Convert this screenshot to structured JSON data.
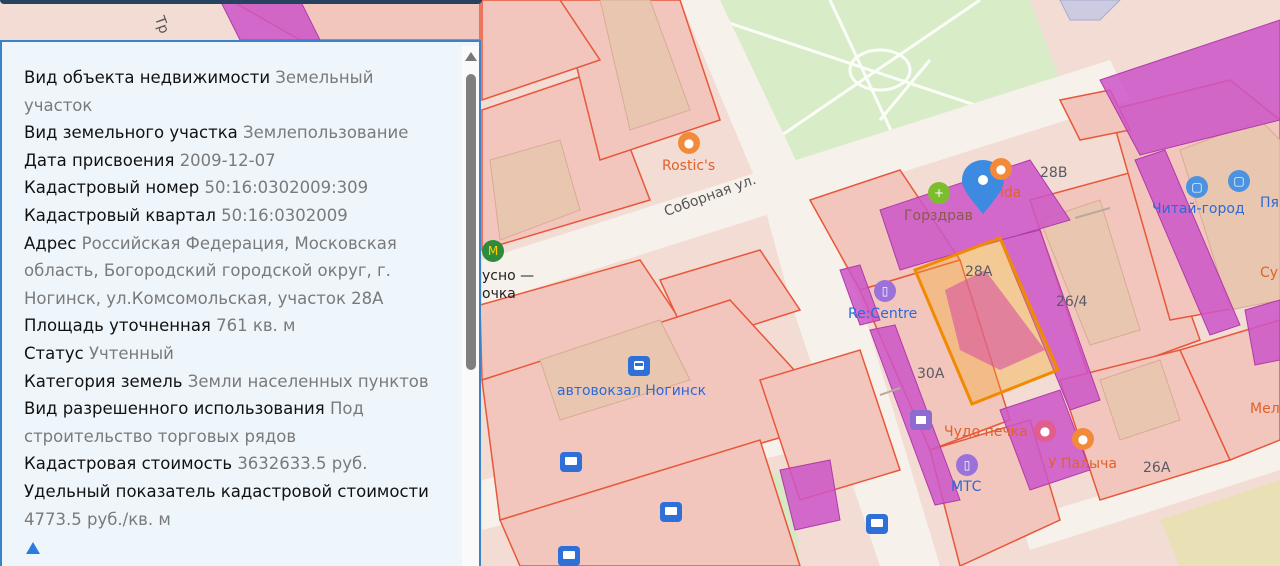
{
  "info_panel": {
    "rows": [
      {
        "label": "Вид объекта недвижимости",
        "value": "Земельный участок"
      },
      {
        "label": "Вид земельного участка",
        "value": "Землепользование"
      },
      {
        "label": "Дата присвоения",
        "value": "2009-12-07"
      },
      {
        "label": "Кадастровый номер",
        "value": "50:16:0302009:309"
      },
      {
        "label": "Кадастровый квартал",
        "value": "50:16:0302009"
      },
      {
        "label": "Адрес",
        "value": "Российская Федерация, Московская область, Богородский городской округ, г. Ногинск, ул.Комсомольская, участок 28А"
      },
      {
        "label": "Площадь уточненная",
        "value": "761 кв. м"
      },
      {
        "label": "Статус",
        "value": "Учтенный"
      },
      {
        "label": "Категория земель",
        "value": "Земли населенных пунктов"
      },
      {
        "label": "Вид разрешенного использования",
        "value": "Под строительство торговых рядов"
      },
      {
        "label": "Кадастровая стоимость",
        "value": "3632633.5 руб."
      },
      {
        "label": "Удельный показатель кадастровой стоимости",
        "value": "4773.5 руб./кв. м"
      }
    ]
  },
  "map": {
    "street_labels": {
      "sobornaya": "Соборная ул.",
      "tr_fragment": "Тр"
    },
    "poi": {
      "rostics": "Rostic's",
      "vkusno_line1": "усно —",
      "vkusno_line2": "очка",
      "gorzdrav": "Горздрав",
      "vida": "ida",
      "re_centre": "Re:Centre",
      "avtovokzal": "автовокзал Ногинск",
      "chudo_pechka": "Чудо печка",
      "u_palycha": "У Палыча",
      "mts": "МТС",
      "chitai_gorod": "Читай-город",
      "pya": "Пя",
      "su": "Су",
      "mel": "Мел"
    },
    "house_numbers": {
      "h28v": "28В",
      "h28a": "28А",
      "h26_4": "26/4",
      "h30a": "30А",
      "h26a": "26А"
    },
    "colors": {
      "parcel_fill": "#f2c6bd",
      "parcel_stroke": "#e8573a",
      "building_magenta": "#cc55c8",
      "selected_parcel": "#f5a623",
      "park": "#d9ecc8",
      "marker": "#3d8be0"
    }
  }
}
